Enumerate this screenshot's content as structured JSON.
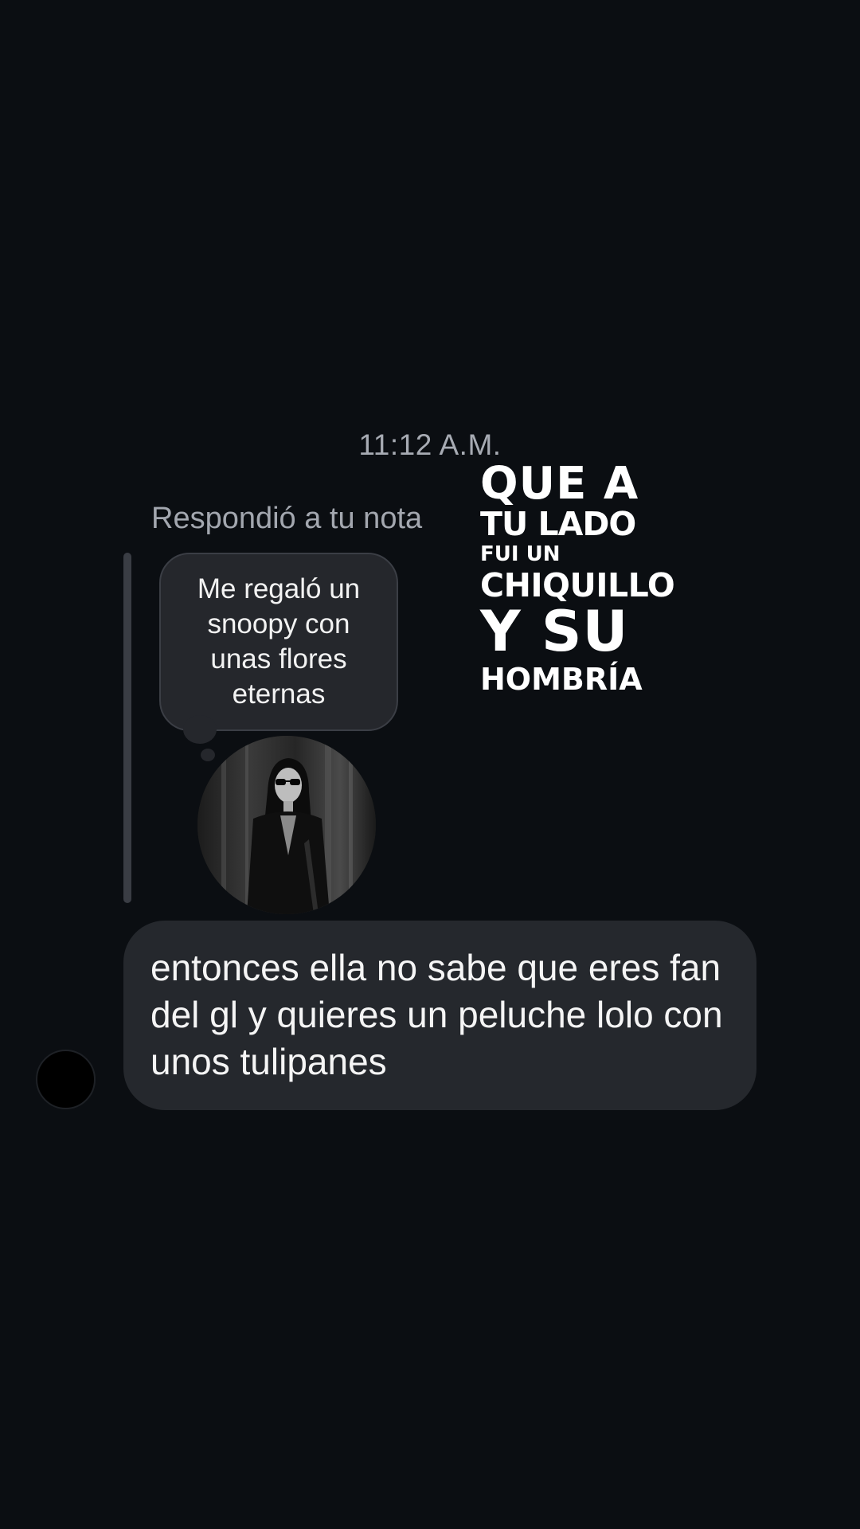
{
  "chat": {
    "timestamp": "11:12 A.M.",
    "reply_label": "Respondió a tu nota",
    "note": {
      "text": "Me regaló un\nsnoopy con\nunas flores\neternas",
      "avatar_icon": "profile-photo-woman-sunglasses"
    },
    "song_lyrics": {
      "line1": "QUE A",
      "line2": "TU LADO",
      "line3": "FUI UN",
      "line4": "CHIQUILLO",
      "line5": "Y SU",
      "line6": "HOMBRÍA"
    },
    "message": {
      "text": "entonces ella no sabe que eres fan del gl y quieres un peluche lolo con unos tulipanes"
    },
    "sender_avatar_icon": "black-circle-avatar"
  }
}
